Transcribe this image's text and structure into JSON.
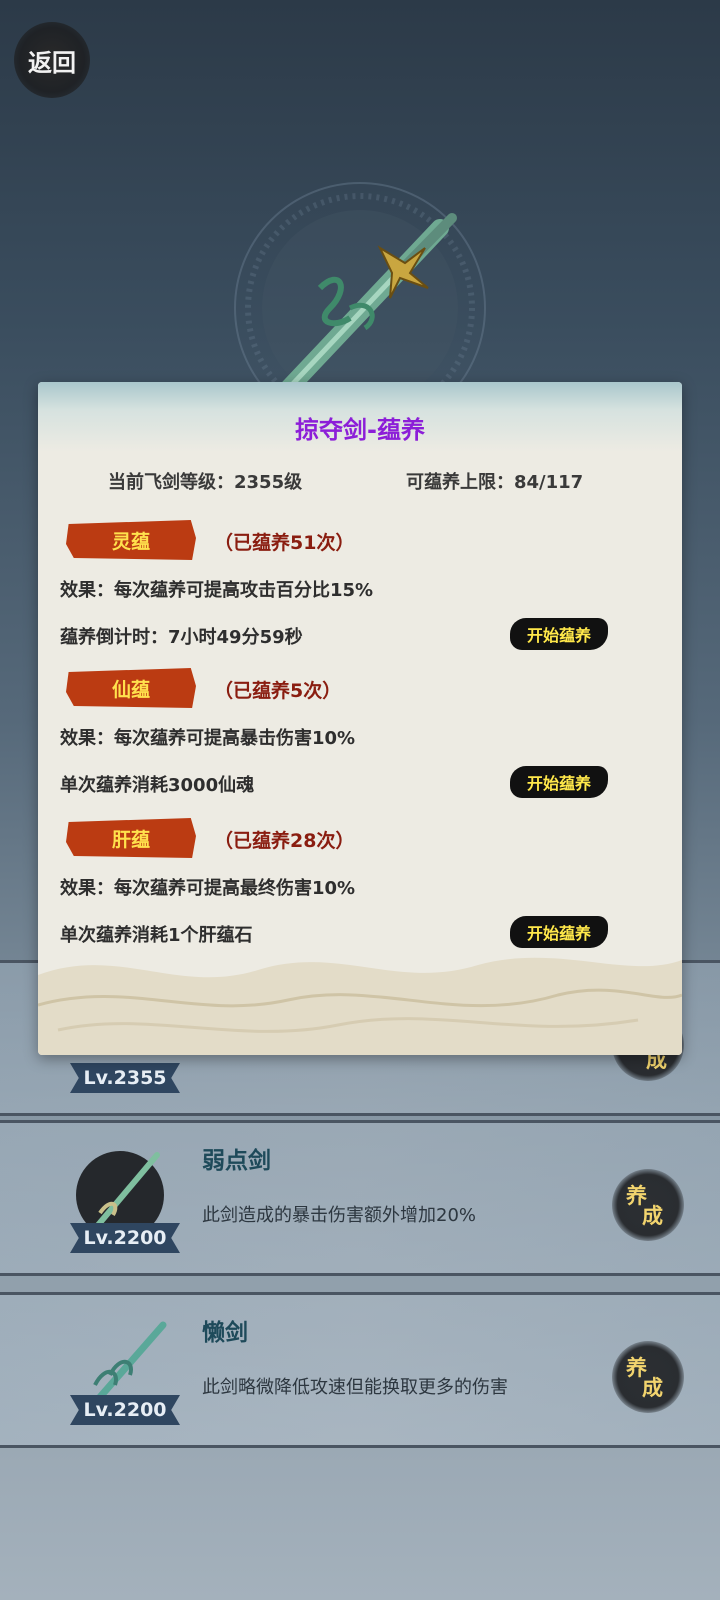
{
  "nav": {
    "back_label": "返回"
  },
  "dialog": {
    "title": "掠夺剑-蕴养",
    "level_label": "当前飞剑等级：",
    "level_value": "2355级",
    "limit_label": "可蕴养上限：",
    "limit_value": "84/117",
    "sections": [
      {
        "tag": "灵蕴",
        "count": "（已蕴养51次）",
        "effect": "效果：每次蕴养可提高攻击百分比15%",
        "line2": "蕴养倒计时：7小时49分59秒",
        "button": "开始蕴养"
      },
      {
        "tag": "仙蕴",
        "count": "（已蕴养5次）",
        "effect": "效果：每次蕴养可提高暴击伤害10%",
        "line2": "单次蕴养消耗3000仙魂",
        "button": "开始蕴养"
      },
      {
        "tag": "肝蕴",
        "count": "（已蕴养28次）",
        "effect": "效果：每次蕴养可提高最终伤害10%",
        "line2": "单次蕴养消耗1个肝蕴石",
        "button": "开始蕴养"
      }
    ]
  },
  "list": {
    "items": [
      {
        "lv": "Lv.2355",
        "name": "",
        "desc": "",
        "train_a": "养",
        "train_b": "成"
      },
      {
        "lv": "Lv.2200",
        "name": "弱点剑",
        "desc": "此剑造成的暴击伤害额外增加20%",
        "train_a": "养",
        "train_b": "成"
      },
      {
        "lv": "Lv.2200",
        "name": "懒剑",
        "desc": "此剑略微降低攻速但能换取更多的伤害",
        "train_a": "养",
        "train_b": "成"
      }
    ]
  },
  "colors": {
    "title": "#8c1ed8",
    "tag_bg": "#bb3b12",
    "tag_text": "#ffe14d",
    "count": "#8a1d10",
    "button_text": "#ffe84a"
  }
}
